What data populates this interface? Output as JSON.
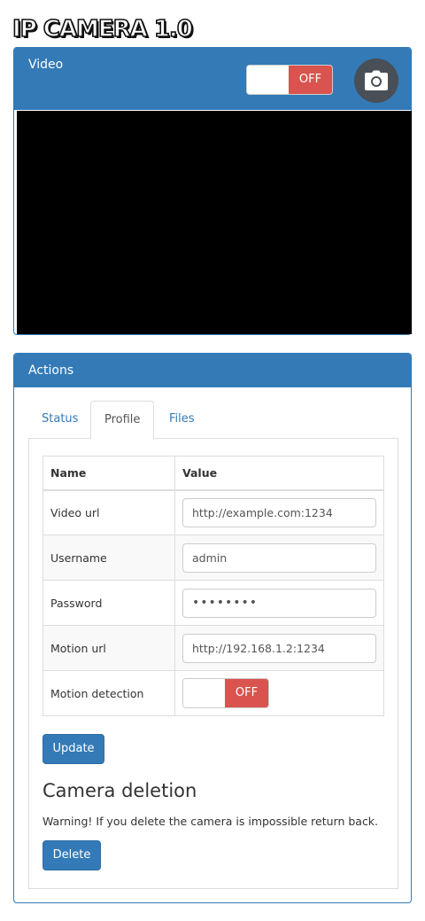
{
  "app": {
    "title": "IP CAMERA 1.0"
  },
  "video_panel": {
    "heading": "Video",
    "toggle_state": "OFF",
    "snapshot_icon": "camera-icon"
  },
  "actions_panel": {
    "heading": "Actions",
    "tabs": [
      {
        "label": "Status",
        "active": false
      },
      {
        "label": "Profile",
        "active": true
      },
      {
        "label": "Files",
        "active": false
      }
    ],
    "table": {
      "headers": [
        "Name",
        "Value"
      ],
      "rows": [
        {
          "name": "Video url",
          "value": "http://example.com:1234"
        },
        {
          "name": "Username",
          "value": "admin"
        },
        {
          "name": "Password",
          "value": "••••••••"
        },
        {
          "name": "Motion url",
          "value": "http://192.168.1.2:1234"
        },
        {
          "name": "Motion detection",
          "value": "OFF"
        }
      ]
    },
    "update_label": "Update",
    "deletion": {
      "title": "Camera deletion",
      "warning": "Warning! If you delete the camera is impossible return back.",
      "delete_label": "Delete"
    }
  },
  "colors": {
    "primary": "#337ab7",
    "danger": "#d9534f",
    "video_bg": "#000000"
  }
}
